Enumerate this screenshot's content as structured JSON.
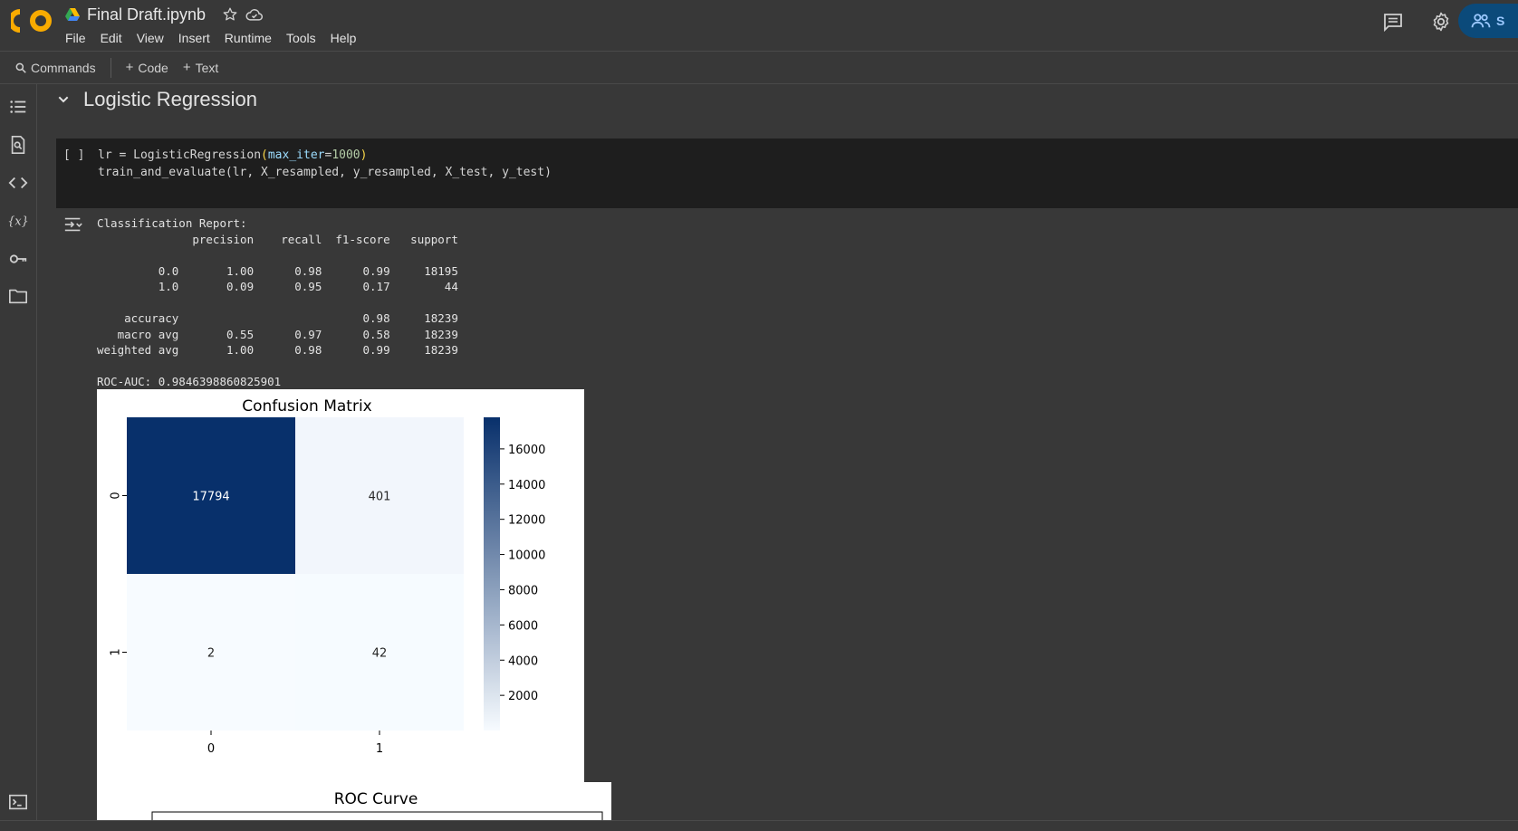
{
  "header": {
    "title": "Final Draft.ipynb",
    "menu": [
      "File",
      "Edit",
      "View",
      "Insert",
      "Runtime",
      "Tools",
      "Help"
    ],
    "share_label": "S"
  },
  "toolbar": {
    "commands": "Commands",
    "code": "Code",
    "text": "Text"
  },
  "sidebar": {
    "icons": [
      "table-of-contents-icon",
      "find-replace-icon",
      "code-snippets-icon",
      "variables-icon",
      "secrets-key-icon",
      "files-folder-icon",
      "terminal-icon"
    ]
  },
  "section": {
    "title": "Logistic Regression"
  },
  "code_cell": {
    "run_indicator": "[ ]",
    "line1": {
      "var": "lr",
      "op": " = ",
      "fn": "LogisticRegression",
      "open": "(",
      "kw": "max_iter",
      "eq": "=",
      "num": "1000",
      "close": ")"
    },
    "line2": {
      "fn": "train_and_evaluate",
      "args": "(lr, X_resampled, y_resampled, X_test, y_test)"
    }
  },
  "output": {
    "report": "Classification Report:\n              precision    recall  f1-score   support\n\n         0.0       1.00      0.98      0.99     18195\n         1.0       0.09      0.95      0.17        44\n\n    accuracy                           0.98     18239\n   macro avg       0.55      0.97      0.58     18239\nweighted avg       1.00      0.98      0.99     18239\n\nROC-AUC: 0.9846398860825901"
  },
  "chart_data": [
    {
      "type": "heatmap",
      "title": "Confusion Matrix",
      "x_categories": [
        "0",
        "1"
      ],
      "y_categories": [
        "0",
        "1"
      ],
      "values": [
        [
          17794,
          401
        ],
        [
          2,
          42
        ]
      ],
      "colormap": "Blues",
      "colorbar_ticks": [
        2000,
        4000,
        6000,
        8000,
        10000,
        12000,
        14000,
        16000
      ],
      "colorbar_range": [
        2,
        17794
      ],
      "colors": {
        "low": "#f7fbff",
        "high": "#08306b"
      }
    },
    {
      "type": "line",
      "title": "ROC Curve"
    }
  ]
}
